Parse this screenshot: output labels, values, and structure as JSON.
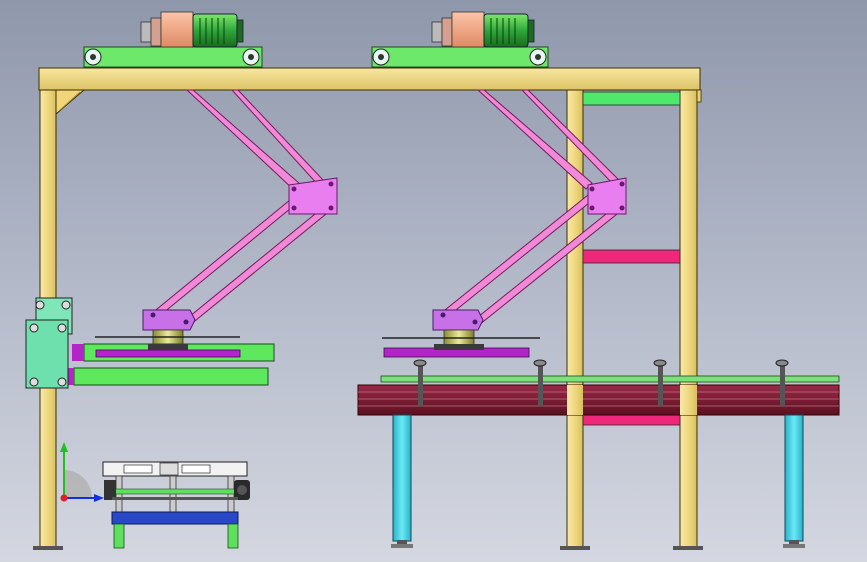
{
  "viewport": {
    "background_top": "#8f97ab",
    "background_bottom": "#d4d7e0"
  },
  "colors": {
    "frame_yellow": "#f5e08c",
    "frame_outline": "#3a3000",
    "motor_green": "#3fc842",
    "belt_green": "#6ee86a",
    "gearbox_orange": "#f5a882",
    "arm_pink": "#f08ad8",
    "plate_violet": "#e87ef0",
    "tray_purple": "#b424c8",
    "crossbar_magenta": "#f0287c",
    "table_top_maroon": "#7a1830",
    "table_leg_cyan": "#3ad6e6",
    "hub_olive": "#d8d878",
    "side_bracket_teal": "#7ee6b8",
    "cart_blue": "#2848c8",
    "cart_white": "#f2f2f2",
    "cart_green": "#5ee05e",
    "axis_x": "#1030e0",
    "axis_y": "#20c020",
    "axis_z": "#e02020"
  },
  "components": {
    "gantry_frame": "gantry-frame",
    "drive_units": [
      "drive-unit-left",
      "drive-unit-right"
    ],
    "manipulators": [
      "manipulator-left",
      "manipulator-right"
    ],
    "conveyor_table": "conveyor-table",
    "transfer_cart": "transfer-cart",
    "triad": "view-orientation-triad"
  }
}
